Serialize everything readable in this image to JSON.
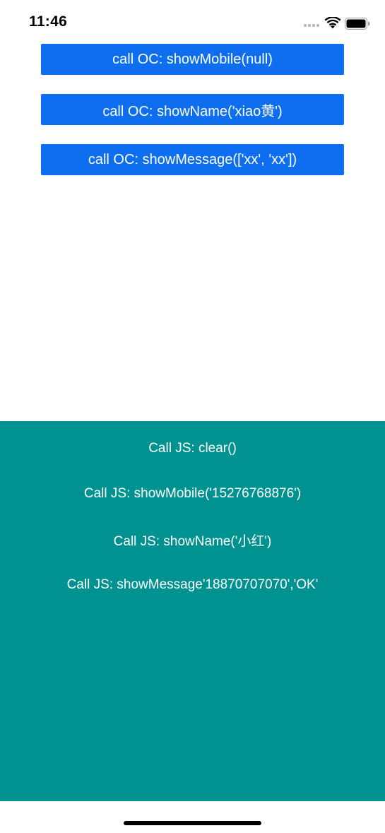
{
  "status_bar": {
    "time": "11:46"
  },
  "web_view": {
    "buttons": [
      {
        "label": "call OC: showMobile(null)"
      },
      {
        "label": "call OC: showName('xiao黄')"
      },
      {
        "label": "call OC: showMessage(['xx', 'xx'])"
      }
    ]
  },
  "native_panel": {
    "background_color": "#009290",
    "buttons": [
      {
        "label": "Call JS: clear()"
      },
      {
        "label": "Call JS: showMobile('15276768876')"
      },
      {
        "label": "Call JS: showName('小红')"
      },
      {
        "label": "Call JS: showMessage'18870707070','OK'"
      }
    ]
  },
  "colors": {
    "button_blue": "#0d6ff0",
    "panel_teal": "#009290"
  },
  "icons": [
    "cellular-signal-icon",
    "wifi-icon",
    "battery-icon"
  ]
}
